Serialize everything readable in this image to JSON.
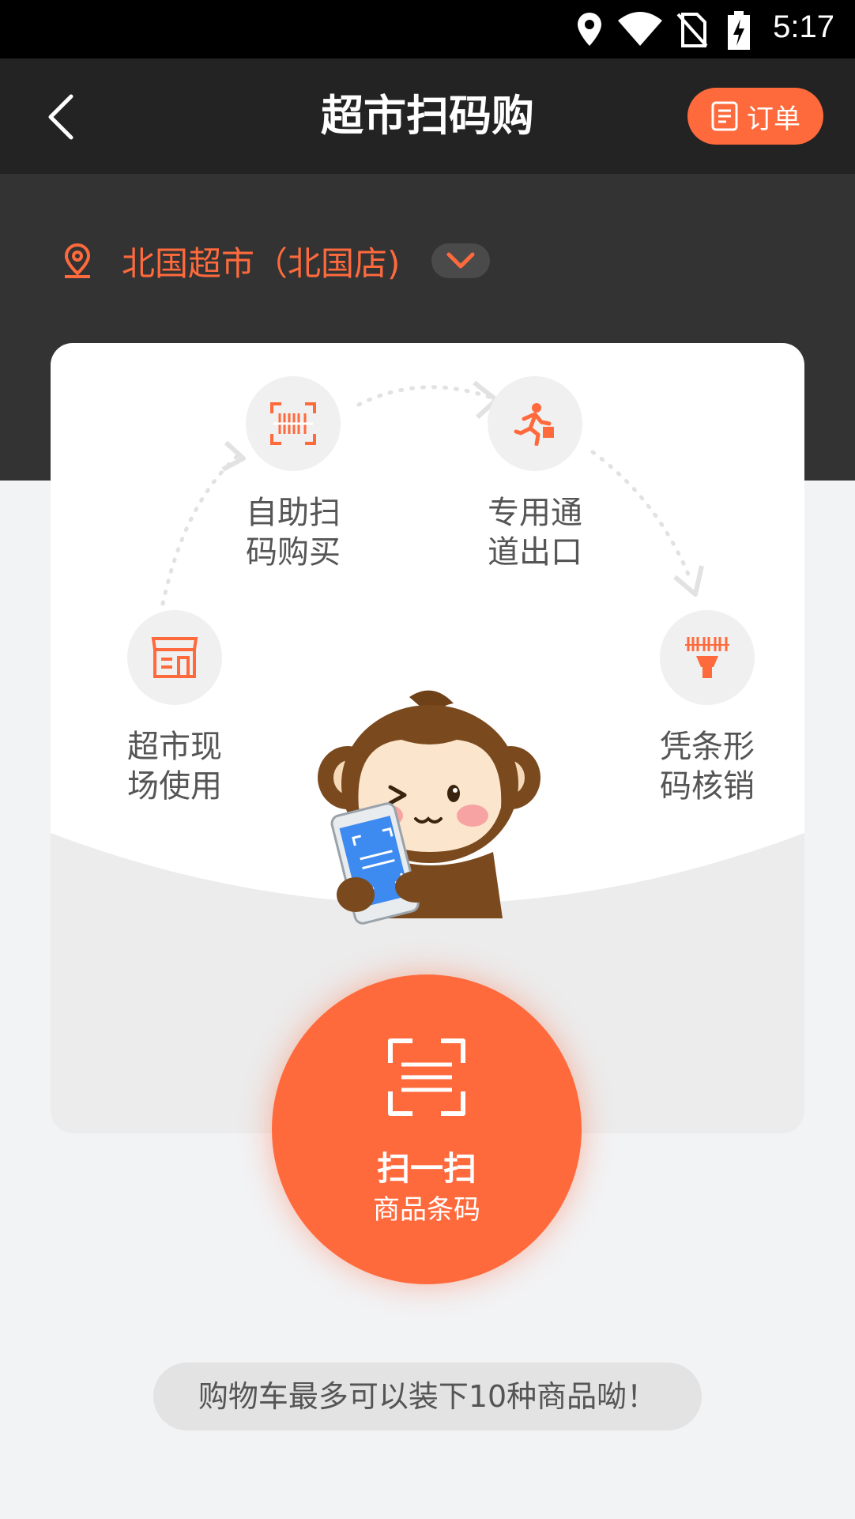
{
  "status_bar": {
    "time": "5:17"
  },
  "header": {
    "title": "超市扫码购",
    "order_button": "订单"
  },
  "store": {
    "name": "北国超市（北国店)"
  },
  "steps": [
    {
      "label": "超市现场使用"
    },
    {
      "label": "自助扫码购买"
    },
    {
      "label": "专用通道出口"
    },
    {
      "label": "凭条形码核销"
    }
  ],
  "scan_button": {
    "main": "扫一扫",
    "sub": "商品条码"
  },
  "tip": "购物车最多可以装下10种商品呦！",
  "colors": {
    "accent": "#ff6a3d",
    "navbar": "#232323",
    "band": "#333333",
    "page": "#f2f3f5"
  }
}
